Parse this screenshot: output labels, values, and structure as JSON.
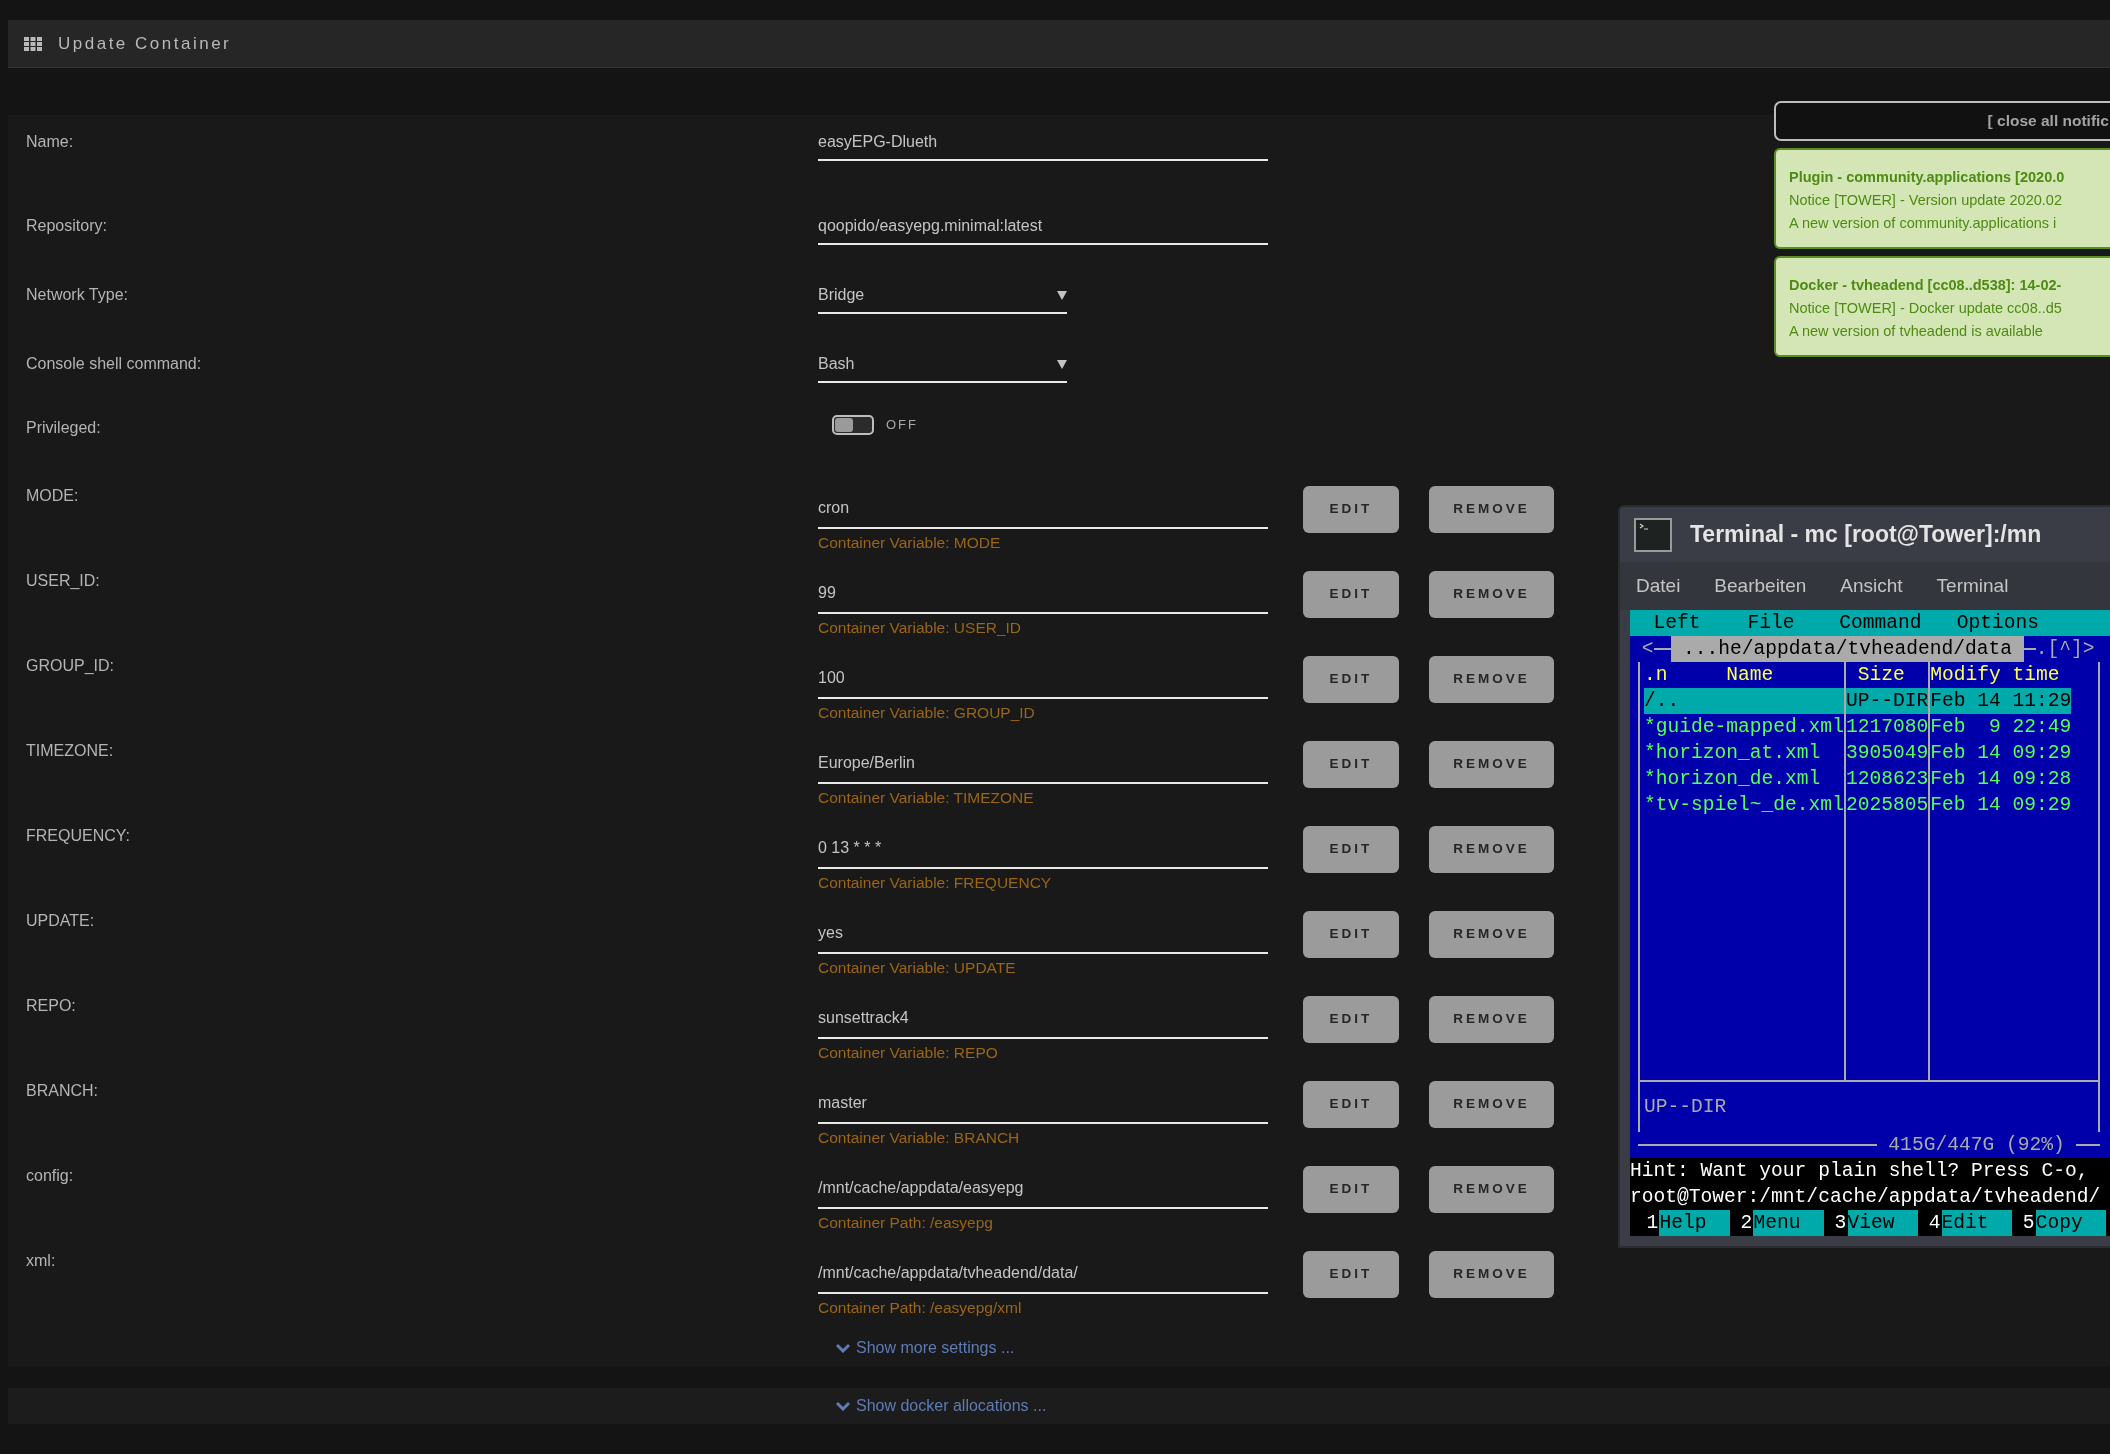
{
  "header": {
    "title": "Update Container"
  },
  "fields": [
    {
      "kind": "text",
      "label": "Name:",
      "value": "easyEPG-Dlueth"
    },
    {
      "kind": "text",
      "label": "Repository:",
      "value": "qoopido/easyepg.minimal:latest"
    },
    {
      "kind": "select",
      "label": "Network Type:",
      "value": "Bridge"
    },
    {
      "kind": "select",
      "label": "Console shell command:",
      "value": "Bash"
    },
    {
      "kind": "switch",
      "label": "Privileged:",
      "on": false,
      "state_text": "OFF"
    }
  ],
  "variables": [
    {
      "label": "MODE:",
      "value": "cron",
      "description": "Container Variable: MODE",
      "edit": "EDIT",
      "remove": "REMOVE"
    },
    {
      "label": "USER_ID:",
      "value": "99",
      "description": "Container Variable: USER_ID",
      "edit": "EDIT",
      "remove": "REMOVE"
    },
    {
      "label": "GROUP_ID:",
      "value": "100",
      "description": "Container Variable: GROUP_ID",
      "edit": "EDIT",
      "remove": "REMOVE"
    },
    {
      "label": "TIMEZONE:",
      "value": "Europe/Berlin",
      "description": "Container Variable: TIMEZONE",
      "edit": "EDIT",
      "remove": "REMOVE"
    },
    {
      "label": "FREQUENCY:",
      "value": "0 13 * * *",
      "description": "Container Variable: FREQUENCY",
      "edit": "EDIT",
      "remove": "REMOVE"
    },
    {
      "label": "UPDATE:",
      "value": "yes",
      "description": "Container Variable: UPDATE",
      "edit": "EDIT",
      "remove": "REMOVE"
    },
    {
      "label": "REPO:",
      "value": "sunsettrack4",
      "description": "Container Variable: REPO",
      "edit": "EDIT",
      "remove": "REMOVE"
    },
    {
      "label": "BRANCH:",
      "value": "master",
      "description": "Container Variable: BRANCH",
      "edit": "EDIT",
      "remove": "REMOVE"
    },
    {
      "label": "config:",
      "value": "/mnt/cache/appdata/easyepg",
      "description": "Container Path: /easyepg",
      "edit": "EDIT",
      "remove": "REMOVE"
    },
    {
      "label": "xml:",
      "value": "/mnt/cache/appdata/tvheadend/data/",
      "description": "Container Path: /easyepg/xml",
      "edit": "EDIT",
      "remove": "REMOVE"
    }
  ],
  "show_more": "Show more settings ...",
  "show_allocations": "Show docker allocations ...",
  "notifications": {
    "close_all": "[ close all notific",
    "items": [
      {
        "title": "Plugin - community.applications [2020.0",
        "lines": [
          "Notice [TOWER] - Version update 2020.02",
          "A new version of community.applications i"
        ]
      },
      {
        "title": "Docker - tvheadend [cc08..d538]: 14-02-",
        "lines": [
          "Notice [TOWER] - Docker update cc08..d5",
          "A new version of tvheadend is available"
        ]
      }
    ]
  },
  "terminal": {
    "title": "Terminal - mc [root@Tower]:/mn",
    "menu": [
      "Datei",
      "Bearbeiten",
      "Ansicht",
      "Terminal"
    ],
    "mc_menu": [
      "Left",
      "File",
      "Command",
      "Options"
    ],
    "nav_left": "<",
    "path": " ...he/appdata/tvheadend/data ",
    "nav_right": ".[^]>",
    "columns": [
      ".n",
      "Name",
      "Size",
      "Modify time"
    ],
    "files": [
      {
        "name": "/..",
        "size": "UP--DIR",
        "time": "Feb 14 11:29",
        "selected": true
      },
      {
        "name": "*guide-mapped.xml",
        "size": "1217080",
        "time": "Feb  9 22:49",
        "selected": false
      },
      {
        "name": "*horizon_at.xml",
        "size": "3905049",
        "time": "Feb 14 09:29",
        "selected": false
      },
      {
        "name": "*horizon_de.xml",
        "size": "1208623",
        "time": "Feb 14 09:28",
        "selected": false
      },
      {
        "name": "*tv-spiel~_de.xml",
        "size": "2025805",
        "time": "Feb 14 09:29",
        "selected": false
      }
    ],
    "status": "UP--DIR",
    "disk": "415G/447G (92%)",
    "hint": "Hint: Want your plain shell? Press C-o,",
    "prompt": "root@Tower:/mnt/cache/appdata/tvheadend/",
    "keys": [
      {
        "num": "1",
        "label": "Help"
      },
      {
        "num": "2",
        "label": "Menu"
      },
      {
        "num": "3",
        "label": "View"
      },
      {
        "num": "4",
        "label": "Edit"
      },
      {
        "num": "5",
        "label": "Copy"
      }
    ]
  }
}
